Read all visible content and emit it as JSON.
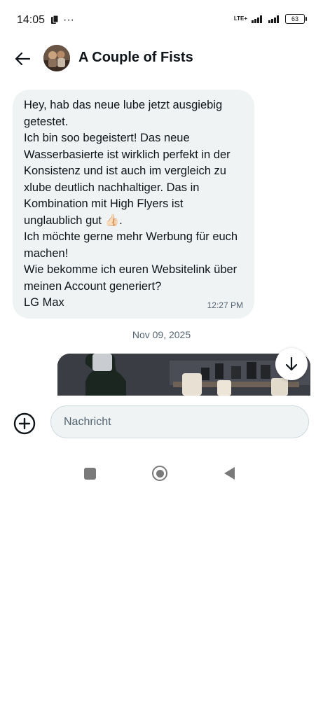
{
  "status_bar": {
    "time": "14:05",
    "overflow_indicator": "···",
    "network": "LTE+",
    "battery": "63"
  },
  "header": {
    "title": "A Couple of Fists",
    "back_icon": "arrow-left-icon"
  },
  "message": {
    "text": "Hey, hab das neue lube jetzt ausgiebig getestet.\nIch bin soo begeistert! Das neue Wasserbasierte ist wirklich perfekt in der Konsistenz und ist auch im vergleich zu xlube deutlich nachhaltiger. Das in Kombination mit High Flyers ist unglaublich gut 👍🏻.\nIch möchte gerne mehr Werbung für euch machen!\nWie bekomme ich euren  Websitelink über meinen Account generiert?\nLG Max",
    "time": "12:27 PM"
  },
  "date_separator": "Nov 09, 2025",
  "composer": {
    "placeholder": "Nachricht",
    "add_icon": "plus-circle-icon"
  },
  "colors": {
    "bubble_bg": "#eff3f4",
    "text_primary": "#0f1419",
    "text_secondary": "#536471"
  }
}
